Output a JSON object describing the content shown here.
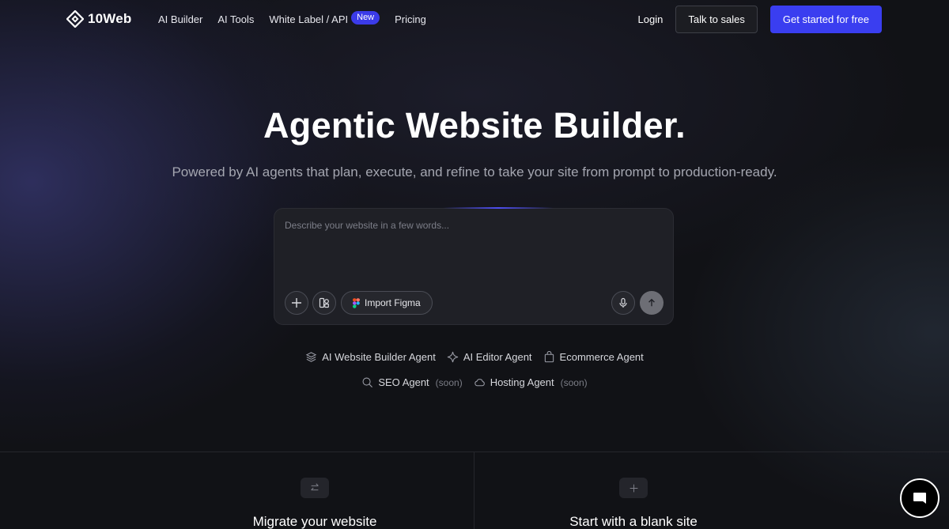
{
  "nav": {
    "brand": "10Web",
    "links": [
      {
        "label": "AI Builder"
      },
      {
        "label": "AI Tools"
      },
      {
        "label": "White Label / API",
        "badge": "New"
      },
      {
        "label": "Pricing"
      }
    ],
    "login": "Login",
    "talk_to_sales": "Talk to sales",
    "get_started": "Get started for free"
  },
  "hero": {
    "title": "Agentic Website Builder.",
    "subtitle": "Powered by AI agents that plan, execute, and refine to take your site from prompt to production-ready."
  },
  "prompt": {
    "placeholder": "Describe your website in a few words...",
    "import_figma": "Import Figma"
  },
  "agents": {
    "row1": [
      {
        "label": "AI Website Builder Agent",
        "icon": "layers-icon"
      },
      {
        "label": "AI Editor Agent",
        "icon": "sparkle-icon"
      },
      {
        "label": "Ecommerce Agent",
        "icon": "bag-icon"
      }
    ],
    "row2": [
      {
        "label": "SEO Agent",
        "soon": "(soon)",
        "icon": "search-icon"
      },
      {
        "label": "Hosting Agent",
        "soon": "(soon)",
        "icon": "cloud-icon"
      }
    ]
  },
  "cards": {
    "migrate": "Migrate your website",
    "blank": "Start with a blank site"
  },
  "colors": {
    "accent": "#3a3ef0",
    "background": "#111216",
    "panel": "#1f2026"
  }
}
